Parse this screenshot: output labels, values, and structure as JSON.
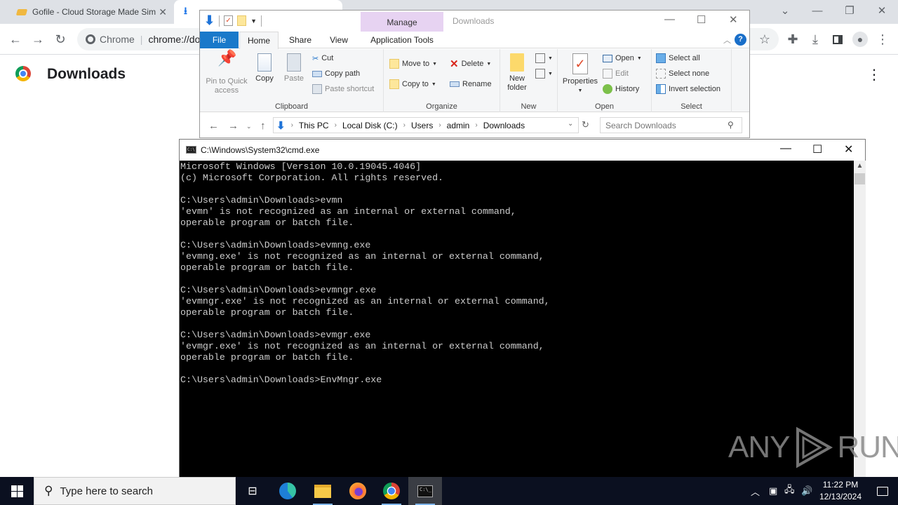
{
  "chrome": {
    "tabs": [
      {
        "title": "Gofile - Cloud Storage Made Sim",
        "icon": "gofile-favicon",
        "close": "✕"
      },
      {
        "title": "Downloads",
        "icon": "download-favicon"
      }
    ],
    "window_controls": {
      "tab_search": "⌄",
      "minimize": "—",
      "restore": "❐",
      "close": "✕"
    },
    "omnibox": {
      "site_label": "Chrome",
      "url": "chrome://downloads"
    },
    "page": {
      "title": "Downloads"
    }
  },
  "explorer": {
    "title": "Downloads",
    "context_tab": "Manage",
    "tabs": [
      "File",
      "Home",
      "Share",
      "View",
      "Application Tools"
    ],
    "window_controls": {
      "minimize": "—",
      "maximize": "☐",
      "close": "✕"
    },
    "help": "?",
    "ribbon": {
      "clipboard": {
        "label": "Clipboard",
        "pin": "Pin to Quick access",
        "copy": "Copy",
        "paste": "Paste",
        "cut": "Cut",
        "copy_path": "Copy path",
        "paste_shortcut": "Paste shortcut"
      },
      "organize": {
        "label": "Organize",
        "move_to": "Move to",
        "copy_to": "Copy to",
        "delete": "Delete",
        "rename": "Rename"
      },
      "new": {
        "label": "New",
        "new_folder": "New folder"
      },
      "open": {
        "label": "Open",
        "properties": "Properties",
        "open": "Open",
        "edit": "Edit",
        "history": "History"
      },
      "select": {
        "label": "Select",
        "select_all": "Select all",
        "select_none": "Select none",
        "invert": "Invert selection"
      }
    },
    "address": {
      "breadcrumbs": [
        "This PC",
        "Local Disk (C:)",
        "Users",
        "admin",
        "Downloads"
      ]
    },
    "search": {
      "placeholder": "Search Downloads"
    }
  },
  "cmd": {
    "title": "C:\\Windows\\System32\\cmd.exe",
    "window_controls": {
      "minimize": "—",
      "maximize": "☐",
      "close": "✕"
    },
    "lines": [
      "Microsoft Windows [Version 10.0.19045.4046]",
      "(c) Microsoft Corporation. All rights reserved.",
      "",
      "C:\\Users\\admin\\Downloads>evmn",
      "'evmn' is not recognized as an internal or external command,",
      "operable program or batch file.",
      "",
      "C:\\Users\\admin\\Downloads>evmng.exe",
      "'evmng.exe' is not recognized as an internal or external command,",
      "operable program or batch file.",
      "",
      "C:\\Users\\admin\\Downloads>evmngr.exe",
      "'evmngr.exe' is not recognized as an internal or external command,",
      "operable program or batch file.",
      "",
      "C:\\Users\\admin\\Downloads>evmgr.exe",
      "'evmgr.exe' is not recognized as an internal or external command,",
      "operable program or batch file.",
      "",
      "C:\\Users\\admin\\Downloads>EnvMngr.exe"
    ]
  },
  "watermark": {
    "left": "ANY",
    "right": "RUN"
  },
  "taskbar": {
    "search_placeholder": "Type here to search",
    "apps": [
      "Task View",
      "Microsoft Edge",
      "File Explorer",
      "Firefox",
      "Google Chrome",
      "Command Prompt"
    ],
    "clock": {
      "time": "11:22 PM",
      "date": "12/13/2024"
    }
  }
}
